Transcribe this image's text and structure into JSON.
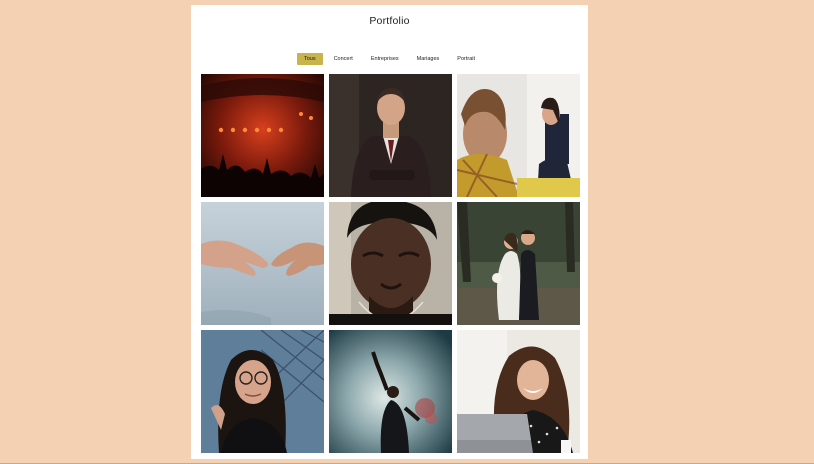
{
  "page": {
    "title": "Portfolio"
  },
  "filters": [
    {
      "label": "Tous",
      "active": true
    },
    {
      "label": "Concert",
      "active": false
    },
    {
      "label": "Entreprises",
      "active": false
    },
    {
      "label": "Mariages",
      "active": false
    },
    {
      "label": "Portrait",
      "active": false
    }
  ],
  "colors": {
    "background": "#f5d1b3",
    "active_filter": "#c8b44a"
  },
  "gallery": [
    {
      "subject": "concert-crowd-photo"
    },
    {
      "subject": "businessman-portrait-photo"
    },
    {
      "subject": "business-meeting-photo"
    },
    {
      "subject": "hands-reaching-photo"
    },
    {
      "subject": "man-closeup-portrait-photo"
    },
    {
      "subject": "wedding-couple-photo"
    },
    {
      "subject": "woman-glasses-portrait-photo"
    },
    {
      "subject": "dancer-smoke-photo"
    },
    {
      "subject": "laughing-woman-laptop-photo"
    }
  ]
}
